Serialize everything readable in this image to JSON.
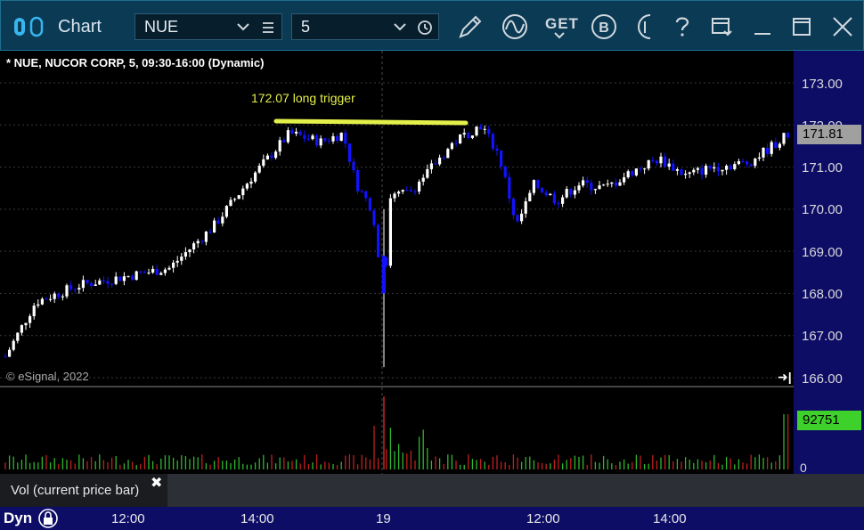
{
  "window": {
    "title": "Chart",
    "symbol": "NUE",
    "interval": "5"
  },
  "toolbar": {
    "get_label": "GET"
  },
  "chart": {
    "heading": "* NUE, NUCOR CORP, 5, 09:30-16:00 (Dynamic)",
    "annotation": "172.07 long trigger",
    "copyright": "© eSignal, 2022",
    "last_price": "171.81",
    "price_axis": [
      "173.00",
      "172.00",
      "171.00",
      "170.00",
      "169.00",
      "168.00",
      "167.00",
      "166.00"
    ],
    "volume_value": "92751",
    "volume_zero": "0",
    "study_label": "Vol (current price bar)",
    "study_close": "✖",
    "scroll_end_glyph": "➜|"
  },
  "timeline": {
    "mode": "Dyn",
    "labels": [
      "12:00",
      "14:00",
      "19",
      "12:00",
      "14:00"
    ]
  },
  "colors": {
    "titlebar_bg": "#0b3a55",
    "up_bar": "#ffffff",
    "down_bar": "#1212ff",
    "trigger_line": "#e4f04a",
    "volume_up": "#2fb82f",
    "volume_down": "#c02020",
    "timebar_bg": "#0d0d66",
    "last_price_bg": "#a0a0a0",
    "volume_badge_bg": "#3fd12b"
  },
  "chart_data": {
    "type": "candlestick",
    "title": "* NUE, NUCOR CORP, 5, 09:30-16:00 (Dynamic)",
    "ylim": [
      165.7,
      174.0
    ],
    "y_ticks": [
      166,
      167,
      168,
      169,
      170,
      171,
      172,
      173
    ],
    "x_tick_labels": [
      "12:00",
      "14:00",
      "19",
      "12:00",
      "14:00"
    ],
    "annotations": [
      {
        "text": "172.07 long trigger",
        "price": 172.07
      }
    ],
    "last_price": 171.81,
    "last_volume": 92751
  }
}
